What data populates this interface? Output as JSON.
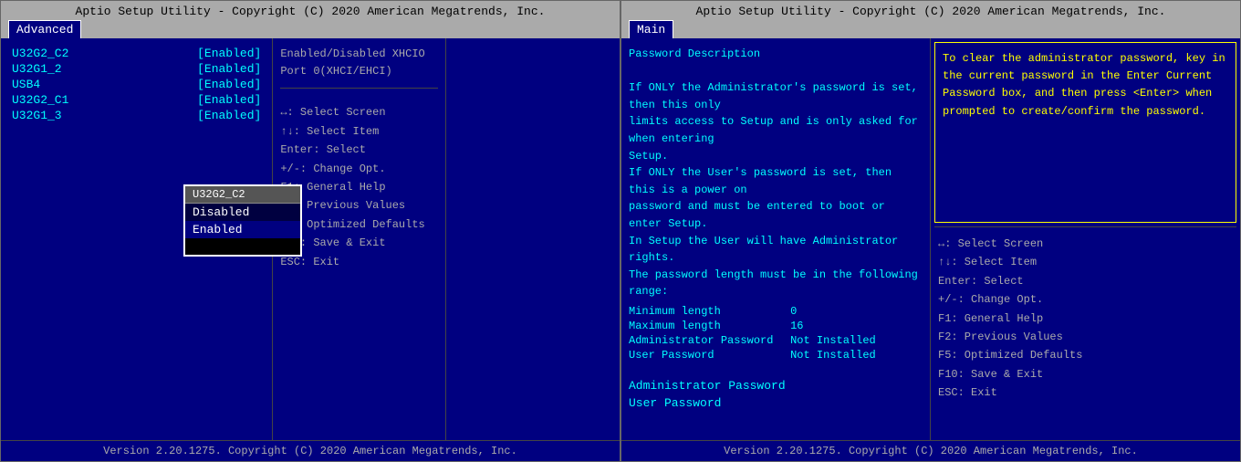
{
  "left_screen": {
    "header": "Aptio Setup Utility - Copyright (C) 2020 American Megatrends, Inc.",
    "tab": "Advanced",
    "menu_items": [
      {
        "name": "U32G2_C2",
        "value": "[Enabled]"
      },
      {
        "name": "U32G1_2",
        "value": "[Enabled]"
      },
      {
        "name": "USB4",
        "value": "[Enabled]"
      },
      {
        "name": "U32G2_C1",
        "value": "[Enabled]"
      },
      {
        "name": "U32G1_3",
        "value": "[Enabled]"
      }
    ],
    "dropdown": {
      "title": "U32G2_C2",
      "options": [
        {
          "label": "Disabled",
          "selected": false
        },
        {
          "label": "Enabled",
          "selected": true
        }
      ]
    },
    "description": "Enabled/Disabled XHCIO Port 0(XHCI/EHCI)",
    "keyboard_hints": [
      "↔: Select Screen",
      "↑↓: Select Item",
      "Enter: Select",
      "+/-: Change Opt.",
      "F1: General Help",
      "F2: Previous Values",
      "F5: Optimized Defaults",
      "F10: Save & Exit",
      "ESC: Exit"
    ],
    "footer": "Version 2.20.1275. Copyright (C) 2020 American Megatrends, Inc."
  },
  "right_screen": {
    "header": "Aptio Setup Utility - Copyright (C) 2020 American Megatrends, Inc.",
    "tab": "Main",
    "password_description": [
      "Password Description",
      "",
      "If ONLY the Administrator's password is set, then this only",
      "limits access to Setup and is only asked for when entering",
      "Setup.",
      "If ONLY the User's password is set, then this is a power on",
      "password and must be entered to boot or enter Setup.",
      "In Setup the User will have Administrator rights.",
      "The password length must be in the following range:"
    ],
    "password_table": [
      {
        "label": "Minimum length",
        "value": "0"
      },
      {
        "label": "Maximum length",
        "value": "16"
      },
      {
        "label": "Administrator Password",
        "value": "Not Installed"
      },
      {
        "label": "User Password",
        "value": "Not Installed"
      }
    ],
    "password_links": [
      "Administrator Password",
      "User Password"
    ],
    "description_right": "To clear the administrator password, key in the current password in the Enter Current Password box, and then press <Enter> when prompted to create/confirm the password.",
    "keyboard_hints": [
      "↔: Select Screen",
      "↑↓: Select Item",
      "Enter: Select",
      "+/-: Change Opt.",
      "F1: General Help",
      "F2: Previous Values",
      "F5: Optimized Defaults",
      "F10: Save & Exit",
      "ESC: Exit"
    ],
    "footer": "Version 2.20.1275. Copyright (C) 2020 American Megatrends, Inc."
  }
}
